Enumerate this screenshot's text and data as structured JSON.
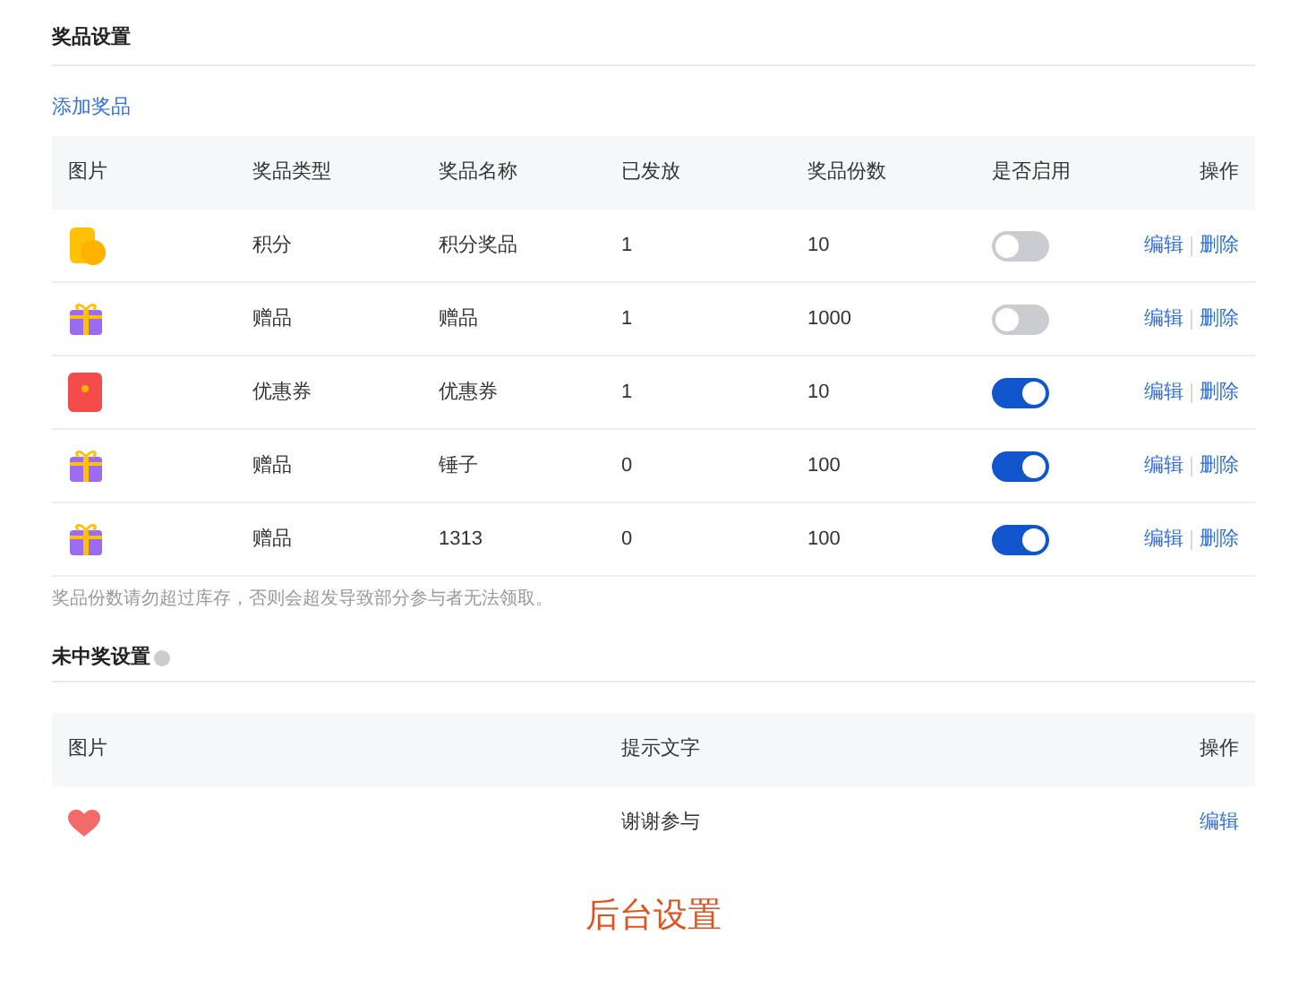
{
  "prize_section": {
    "title": "奖品设置",
    "add_link": "添加奖品",
    "columns": [
      "图片",
      "奖品类型",
      "奖品名称",
      "已发放",
      "奖品份数",
      "是否启用",
      "操作"
    ],
    "rows": [
      {
        "kind": "points",
        "type": "积分",
        "name": "积分奖品",
        "issued": "1",
        "quantity": "10",
        "on": false,
        "actions": [
          "编辑",
          "删除"
        ]
      },
      {
        "kind": "gift",
        "type": "赠品",
        "name": "赠品",
        "issued": "1",
        "quantity": "1000",
        "on": false,
        "actions": [
          "编辑",
          "删除"
        ]
      },
      {
        "kind": "coupon",
        "type": "优惠券",
        "name": "优惠券",
        "issued": "1",
        "quantity": "10",
        "on": true,
        "actions": [
          "编辑",
          "删除"
        ]
      },
      {
        "kind": "gift",
        "type": "赠品",
        "name": "锤子",
        "issued": "0",
        "quantity": "100",
        "on": true,
        "actions": [
          "编辑",
          "删除"
        ]
      },
      {
        "kind": "gift",
        "type": "赠品",
        "name": "1313",
        "issued": "0",
        "quantity": "100",
        "on": true,
        "actions": [
          "编辑",
          "删除"
        ]
      }
    ],
    "note": "奖品份数请勿超过库存，否则会超发导致部分参与者无法领取。"
  },
  "no_prize_section": {
    "title": "未中奖设置",
    "columns": [
      "图片",
      "提示文字",
      "操作"
    ],
    "rows": [
      {
        "kind": "heart",
        "text": "谢谢参与",
        "actions": [
          "编辑"
        ]
      }
    ]
  },
  "caption": "后台设置"
}
